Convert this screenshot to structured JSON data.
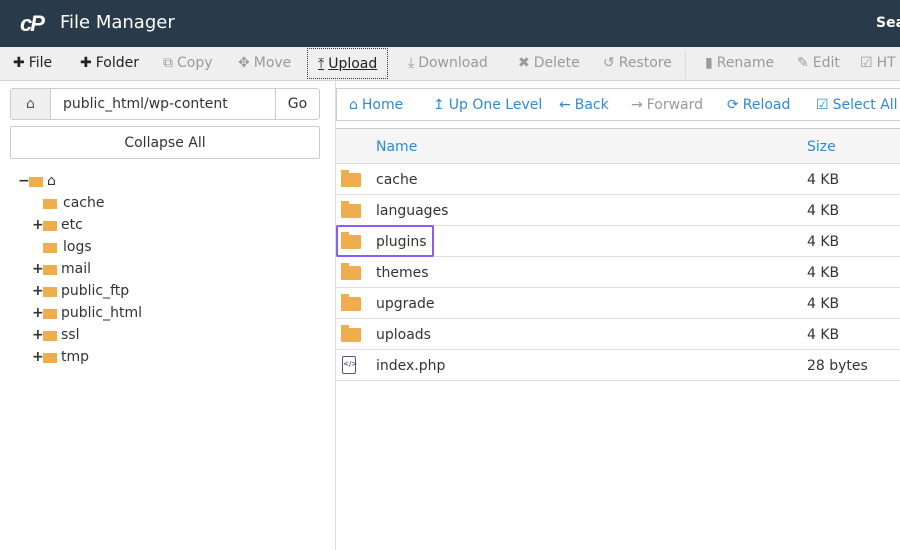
{
  "header": {
    "logo": "cP",
    "title": "File Manager",
    "search_label": "Sea"
  },
  "toolbar": [
    {
      "label": "File",
      "icon": "plus-icon",
      "glyph": "✚",
      "enabled": true
    },
    {
      "label": "Folder",
      "icon": "plus-icon",
      "glyph": "✚",
      "enabled": true
    },
    {
      "label": "Copy",
      "icon": "copy-icon",
      "glyph": "⧉",
      "enabled": false
    },
    {
      "label": "Move",
      "icon": "move-icon",
      "glyph": "✥",
      "enabled": false
    },
    {
      "label": "Upload",
      "icon": "upload-icon",
      "glyph": "⤒",
      "enabled": true
    },
    {
      "label": "Download",
      "icon": "download-icon",
      "glyph": "⤓",
      "enabled": false
    },
    {
      "label": "Delete",
      "icon": "delete-icon",
      "glyph": "✖",
      "enabled": false
    },
    {
      "label": "Restore",
      "icon": "restore-icon",
      "glyph": "↺",
      "enabled": false
    },
    {
      "label": "Rename",
      "icon": "file-icon",
      "glyph": "▮",
      "enabled": false
    },
    {
      "label": "Edit",
      "icon": "pencil-icon",
      "glyph": "✎",
      "enabled": false
    },
    {
      "label": "HT",
      "icon": "edit-icon",
      "glyph": "☑",
      "enabled": false
    }
  ],
  "path": {
    "value": "public_html/wp-content",
    "go": "Go"
  },
  "collapse_all": "Collapse All",
  "tree": [
    {
      "label": "cache",
      "expander": ""
    },
    {
      "label": "etc",
      "expander": "+"
    },
    {
      "label": "logs",
      "expander": ""
    },
    {
      "label": "mail",
      "expander": "+"
    },
    {
      "label": "public_ftp",
      "expander": "+"
    },
    {
      "label": "public_html",
      "expander": "+"
    },
    {
      "label": "ssl",
      "expander": "+"
    },
    {
      "label": "tmp",
      "expander": "+"
    }
  ],
  "nav": [
    {
      "label": "Home",
      "glyph": "⌂",
      "icon": "home-icon",
      "enabled": true
    },
    {
      "label": "Up One Level",
      "glyph": "↥",
      "icon": "level-up-icon",
      "enabled": true
    },
    {
      "label": "Back",
      "glyph": "←",
      "icon": "arrow-left-icon",
      "enabled": true
    },
    {
      "label": "Forward",
      "glyph": "→",
      "icon": "arrow-right-icon",
      "enabled": false
    },
    {
      "label": "Reload",
      "glyph": "⟳",
      "icon": "reload-icon",
      "enabled": true
    },
    {
      "label": "Select All",
      "glyph": "☑",
      "icon": "checkbox-icon",
      "enabled": true
    }
  ],
  "table": {
    "columns": {
      "name": "Name",
      "size": "Size"
    },
    "rows": [
      {
        "name": "cache",
        "size": "4 KB",
        "type": "folder"
      },
      {
        "name": "languages",
        "size": "4 KB",
        "type": "folder"
      },
      {
        "name": "plugins",
        "size": "4 KB",
        "type": "folder",
        "highlighted": true
      },
      {
        "name": "themes",
        "size": "4 KB",
        "type": "folder"
      },
      {
        "name": "upgrade",
        "size": "4 KB",
        "type": "folder"
      },
      {
        "name": "uploads",
        "size": "4 KB",
        "type": "folder"
      },
      {
        "name": "index.php",
        "size": "28 bytes",
        "type": "php"
      }
    ]
  },
  "colors": {
    "header": "#293a4a",
    "link": "#2f8ad6",
    "folder": "#f0ad4e",
    "highlight": "#8b5cf6"
  }
}
